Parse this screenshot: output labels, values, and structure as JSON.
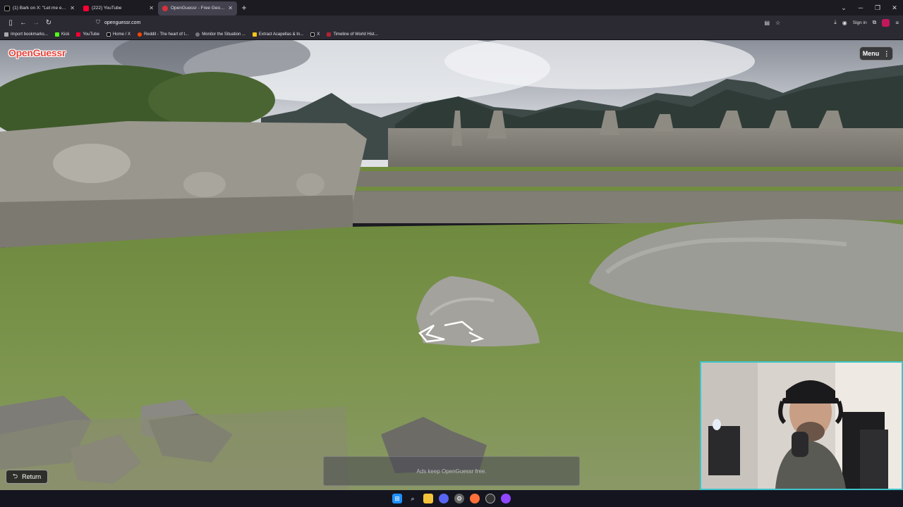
{
  "tabs": [
    {
      "label": "(1) Bark on X: \"Let me explain w",
      "icon": "x-favicon"
    },
    {
      "label": "(222) YouTube",
      "icon": "youtube-favicon"
    },
    {
      "label": "OpenGuessr - Free GeoGue",
      "icon": "openguessr-favicon"
    }
  ],
  "url": "openguessr.com",
  "signin_label": "Sign in",
  "bookmarks": [
    "Import bookmarks...",
    "Kick",
    "YouTube",
    "Home / X",
    "Reddit - The heart of t...",
    "Monitor the Situation ...",
    "Extract Acapellas & In...",
    "X",
    "Timeline of World Hist..."
  ],
  "game": {
    "logo_text": "OpenGuessr",
    "menu_label": "Menu",
    "return_label": "Return",
    "ad_text": "Ads keep OpenGuessr free."
  },
  "colors": {
    "brand_red": "#e8453c",
    "webcam_border": "#3fc4c9",
    "browser_bg": "#1c1b22"
  }
}
